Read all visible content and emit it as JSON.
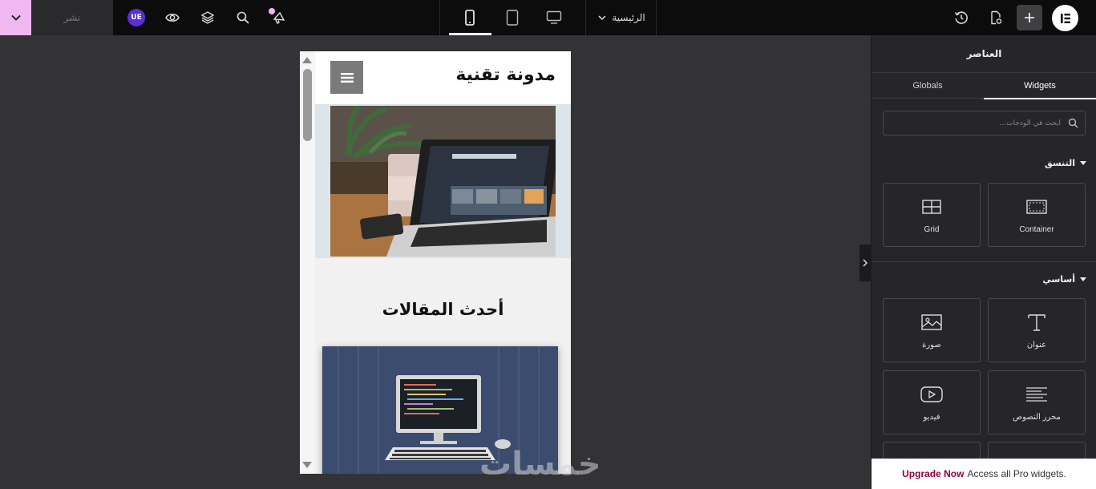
{
  "topbar": {
    "publish_label": "نشر",
    "ue_badge": "UE",
    "page_name": "الرئيسية",
    "devices": [
      "mobile-icon",
      "tablet-icon",
      "desktop-icon"
    ],
    "active_device": "mobile",
    "accent": "#f0b7f1"
  },
  "preview": {
    "site_title": "مدونة تقنية",
    "latest_heading": "أحدث المقالات"
  },
  "watermark": "خمسات",
  "panel": {
    "title": "العناصر",
    "tabs": {
      "globals": "Globals",
      "widgets": "Widgets"
    },
    "active_tab": "Widgets",
    "search_placeholder": "ابحث في الودجات...",
    "categories": [
      {
        "name": "التنسق",
        "widgets": [
          {
            "label": "Grid",
            "icon": "grid-icon"
          },
          {
            "label": "Container",
            "icon": "container-icon"
          }
        ]
      },
      {
        "name": "أساسي",
        "widgets": [
          {
            "label": "صورة",
            "icon": "image-icon"
          },
          {
            "label": "عنوان",
            "icon": "heading-icon"
          },
          {
            "label": "فيديو",
            "icon": "video-icon"
          },
          {
            "label": "محرر النصوص",
            "icon": "text-editor-icon"
          }
        ]
      }
    ],
    "upgrade": {
      "text": "Access all Pro widgets.",
      "link": "Upgrade Now"
    }
  }
}
